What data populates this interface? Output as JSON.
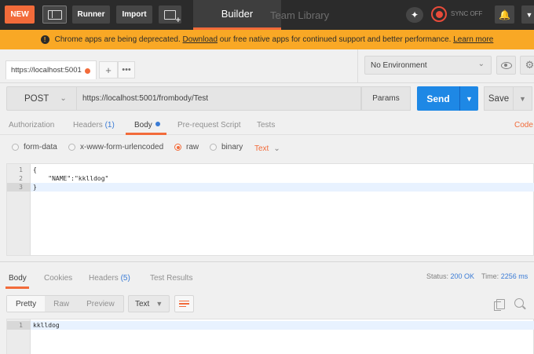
{
  "topbar": {
    "new_label": "NEW",
    "runner_label": "Runner",
    "import_label": "Import",
    "builder_tab": "Builder",
    "team_library_tab": "Team Library",
    "sync_label": "SYNC OFF"
  },
  "banner": {
    "text_before": "Chrome apps are being deprecated.",
    "download_link": "Download",
    "text_middle": "our free native apps for continued support and better performance.",
    "learn_more_link": "Learn more"
  },
  "tabs": {
    "request_tab_label": "https://localhost:5001",
    "add_tab": "+",
    "more_tabs": "•••"
  },
  "environment": {
    "selected": "No Environment"
  },
  "request": {
    "method": "POST",
    "url": "https://localhost:5001/frombody/Test",
    "params_label": "Params",
    "send_label": "Send",
    "save_label": "Save"
  },
  "request_tabs": {
    "authorization": "Authorization",
    "headers": "Headers",
    "headers_count": "(1)",
    "body": "Body",
    "prerequest": "Pre-request Script",
    "tests": "Tests",
    "code_link": "Code"
  },
  "body_types": {
    "form_data": "form-data",
    "urlencoded": "x-www-form-urlencoded",
    "raw": "raw",
    "binary": "binary",
    "selected": "raw",
    "format": "Text"
  },
  "request_body": {
    "lines": [
      {
        "num": "1",
        "text": "{"
      },
      {
        "num": "2",
        "text": "    \"NAME\":\"kklldog\""
      },
      {
        "num": "3",
        "text": "}"
      }
    ]
  },
  "response_tabs": {
    "body": "Body",
    "cookies": "Cookies",
    "headers": "Headers",
    "headers_count": "(5)",
    "test_results": "Test Results"
  },
  "response_meta": {
    "status_label": "Status:",
    "status_value": "200 OK",
    "time_label": "Time:",
    "time_value": "2256 ms"
  },
  "response_view": {
    "pretty": "Pretty",
    "raw": "Raw",
    "preview": "Preview",
    "format": "Text"
  },
  "response_body": {
    "lines": [
      {
        "num": "1",
        "text": "kklldog"
      }
    ]
  },
  "colors": {
    "accent": "#f26b3a",
    "send_blue": "#1e88e5",
    "banner_yellow": "#f9a825",
    "topbar_dark": "#2b2b2b"
  },
  "icons": [
    "layout-icon",
    "new-window-icon",
    "interceptor-icon",
    "sync-icon",
    "bell-icon",
    "chevron-down-icon",
    "warning-icon",
    "eye-icon",
    "gear-icon",
    "wrap-lines-icon",
    "copy-icon",
    "search-icon"
  ]
}
